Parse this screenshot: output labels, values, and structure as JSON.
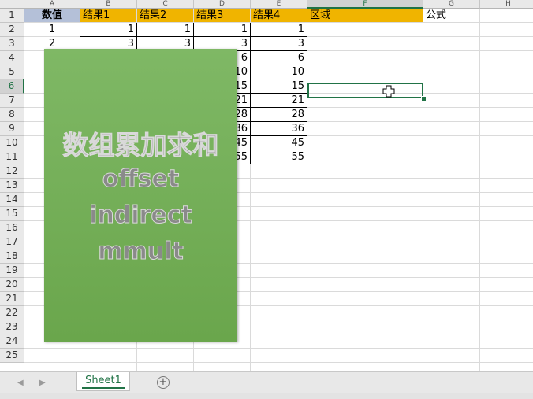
{
  "columns": [
    "A",
    "B",
    "C",
    "D",
    "E",
    "F",
    "G",
    "H"
  ],
  "rows": [
    "1",
    "2",
    "3",
    "4",
    "5",
    "6",
    "7",
    "8",
    "9",
    "10",
    "11",
    "12",
    "13",
    "14",
    "15",
    "16",
    "17",
    "18",
    "19",
    "20",
    "21",
    "22",
    "23",
    "24",
    "25"
  ],
  "header_row": {
    "a": "数值",
    "b": "结果1",
    "c": "结果2",
    "d": "结果3",
    "e": "结果4",
    "f": "区域",
    "g": "公式"
  },
  "col_a_values": [
    "1",
    "2"
  ],
  "col_b_values": [
    "1",
    "3"
  ],
  "col_c_values": [
    "1",
    "3"
  ],
  "col_d_values": [
    "1",
    "3",
    "6",
    "10",
    "15",
    "21",
    "28",
    "36",
    "45",
    "55"
  ],
  "col_e_values": [
    "1",
    "3",
    "6",
    "10",
    "15",
    "21",
    "28",
    "36",
    "45",
    "55"
  ],
  "selected_cell": "F6",
  "overlay": {
    "title": "数组累加求和",
    "line2": "offset",
    "line3": "indirect",
    "line4": "mmult",
    "color": "#6aa64c"
  },
  "sheet_tab": "Sheet1",
  "add_sheet_icon": "plus-circle-icon",
  "accent_color": "#217346",
  "header_fill_color": "#f0b400"
}
